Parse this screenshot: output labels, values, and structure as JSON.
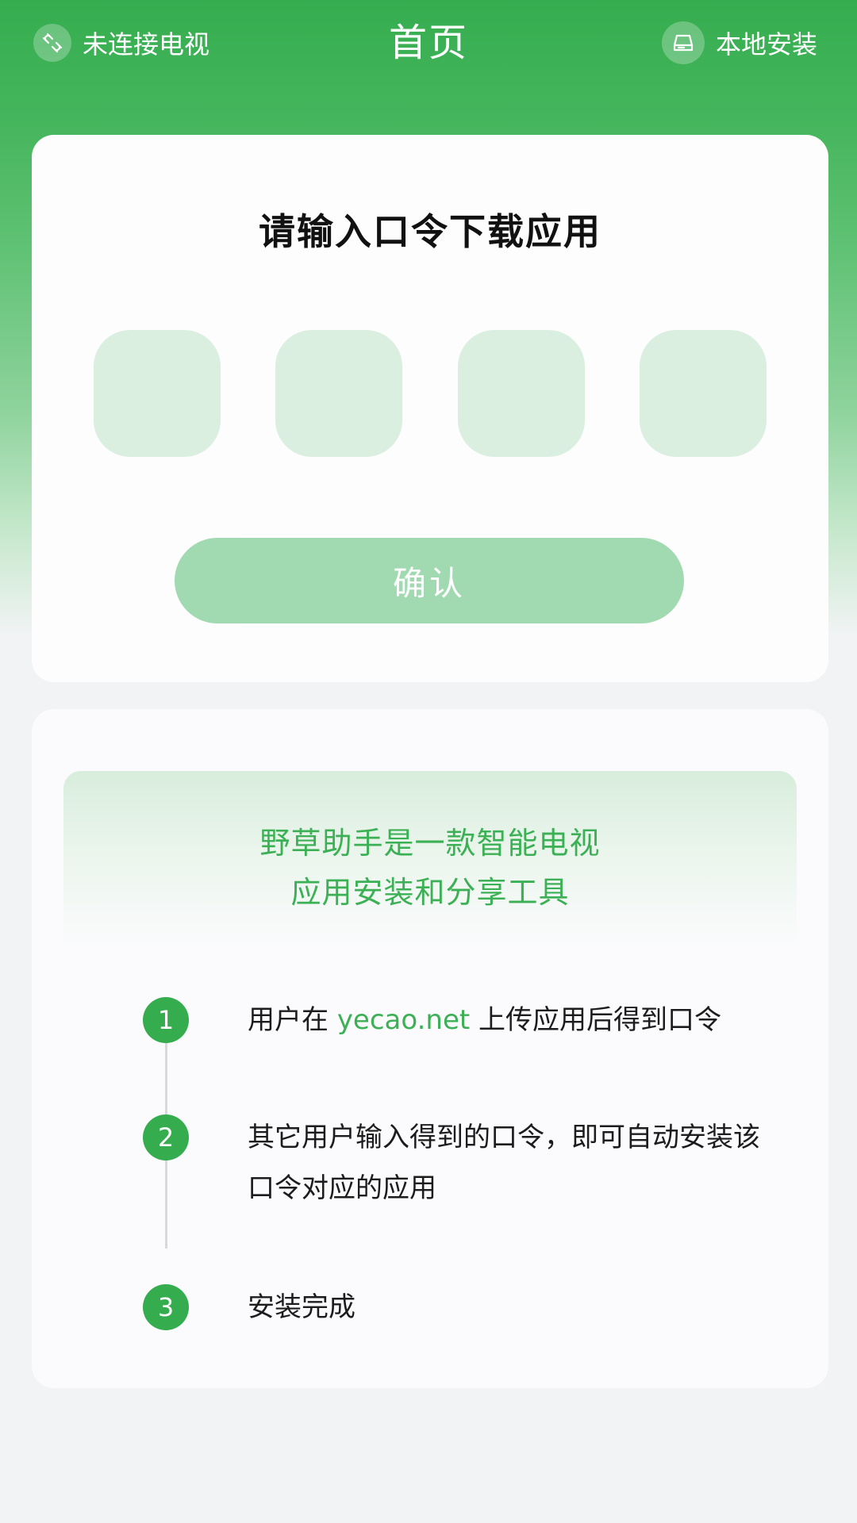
{
  "header": {
    "title": "首页",
    "tv_status": "未连接电视",
    "tv_status_icon": "link-broken-icon",
    "local_install": "本地安装",
    "local_install_icon": "drive-icon"
  },
  "code_card": {
    "title": "请输入口令下载应用",
    "code_slots": [
      "",
      "",
      "",
      ""
    ],
    "confirm_label": "确认"
  },
  "info_card": {
    "intro_line1": "野草助手是一款智能电视",
    "intro_line2": "应用安装和分享工具",
    "steps": [
      {
        "number": "1",
        "text_before": "用户在 ",
        "link": "yecao.net",
        "text_after": " 上传应用后得到口令"
      },
      {
        "number": "2",
        "text": "其它用户输入得到的口令，即可自动安装该口令对应的应用"
      },
      {
        "number": "3",
        "text": "安装完成"
      }
    ]
  },
  "colors": {
    "brand_green": "#35ad4f",
    "code_box_bg": "#dbefe0",
    "confirm_disabled": "#a1d9b1",
    "page_bg": "#f2f3f5"
  }
}
